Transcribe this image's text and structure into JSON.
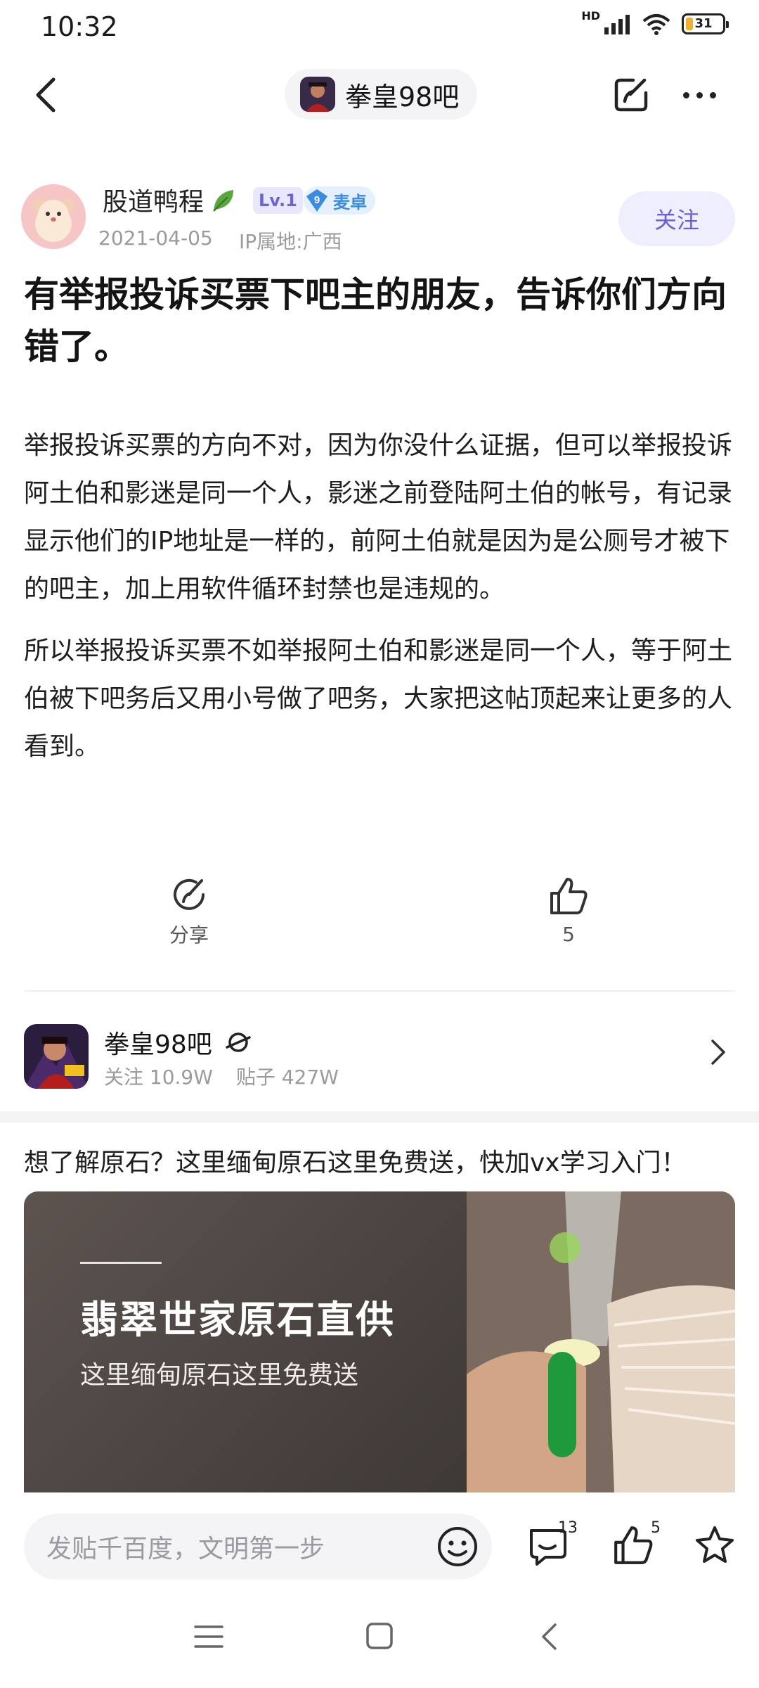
{
  "status_bar": {
    "time": "10:32",
    "network": "HD",
    "battery": "31"
  },
  "nav": {
    "forum_title": "拳皇98吧"
  },
  "post": {
    "author": "股道鸭程",
    "level": "Lv.1",
    "fan_level": "9",
    "fan_tag": "麦卓",
    "date": "2021-04-05",
    "ip_location": "IP属地:广西",
    "follow_label": "关注",
    "title": "有举报投诉买票下吧主的朋友，告诉你们方向错了。",
    "paragraphs": [
      "举报投诉买票的方向不对，因为你没什么证据，但可以举报投诉阿土伯和影迷是同一个人，影迷之前登陆阿土伯的帐号，有记录显示他们的IP地址是一样的，前阿土伯就是因为是公厕号才被下的吧主，加上用软件循环封禁也是违规的。",
      "所以举报投诉买票不如举报阿土伯和影迷是同一个人，等于阿土伯被下吧务后又用小号做了吧务，大家把这帖顶起来让更多的人看到。"
    ],
    "share_label": "分享",
    "like_count": "5"
  },
  "forum_card": {
    "name": "拳皇98吧",
    "followers": "关注 10.9W",
    "posts": "贴子 427W"
  },
  "ad": {
    "text": "想了解原石？这里缅甸原石这里免费送，快加vx学习入门！",
    "headline": "翡翠世家原石直供",
    "subline": "这里缅甸原石这里免费送"
  },
  "bottom_bar": {
    "input_placeholder": "发贴千百度，文明第一步",
    "comment_count": "13",
    "like_count": "5"
  }
}
